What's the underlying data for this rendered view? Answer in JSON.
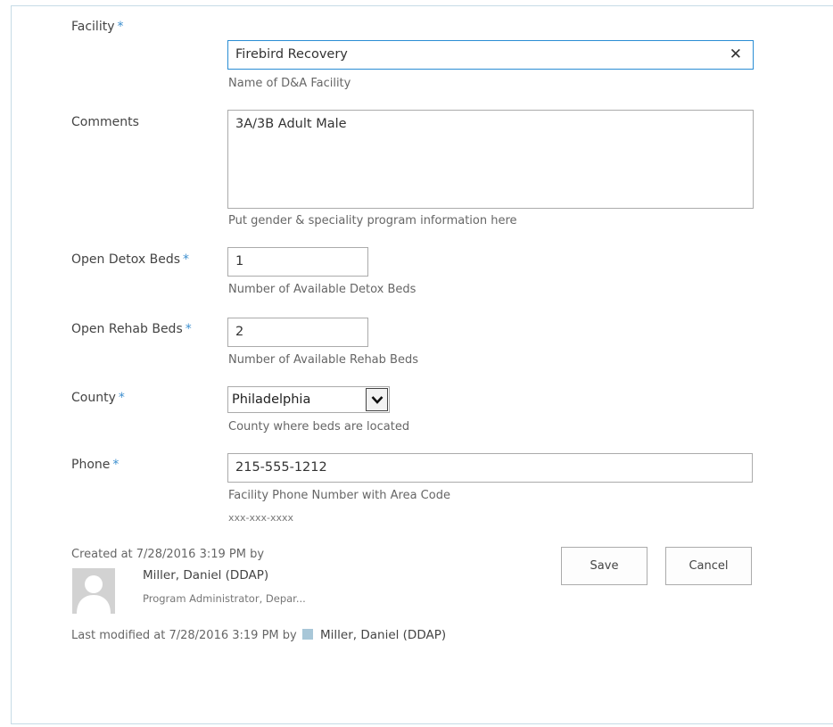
{
  "form": {
    "facility": {
      "label": "Facility",
      "required_mark": "*",
      "value": "Firebird Recovery",
      "hint": "Name of D&A Facility"
    },
    "comments": {
      "label": "Comments",
      "value": "3A/3B Adult Male",
      "hint": "Put gender & speciality program information here"
    },
    "open_detox_beds": {
      "label": "Open Detox Beds",
      "required_mark": "*",
      "value": "1",
      "hint": "Number of Available Detox Beds"
    },
    "open_rehab_beds": {
      "label": "Open Rehab Beds",
      "required_mark": "*",
      "value": "2",
      "hint": "Number of Available Rehab Beds"
    },
    "county": {
      "label": "County",
      "required_mark": "*",
      "selected": "Philadelphia",
      "hint": "County where beds are located"
    },
    "phone": {
      "label": "Phone",
      "required_mark": "*",
      "value": "215-555-1212",
      "hint": "Facility Phone Number with Area Code",
      "format": "xxx-xxx-xxxx"
    }
  },
  "meta": {
    "created_text": "Created at 7/28/2016 3:19 PM  by",
    "created_by_name": "Miller, Daniel (DDAP)",
    "created_by_title": "Program Administrator, Depar...",
    "modified_text": "Last modified at 7/28/2016 3:19 PM  by",
    "modified_by_name": "Miller, Daniel (DDAP)"
  },
  "buttons": {
    "save": "Save",
    "cancel": "Cancel"
  },
  "icons": {
    "clear": "close-icon",
    "dropdown": "chevron-down-icon",
    "avatar": "user-avatar-icon",
    "presence": "presence-indicator-icon"
  },
  "colors": {
    "required": "#3d8fcf",
    "focus_border": "#2a8dd4",
    "frame_border": "#c6dbe6",
    "presence": "#a8c7d8"
  }
}
